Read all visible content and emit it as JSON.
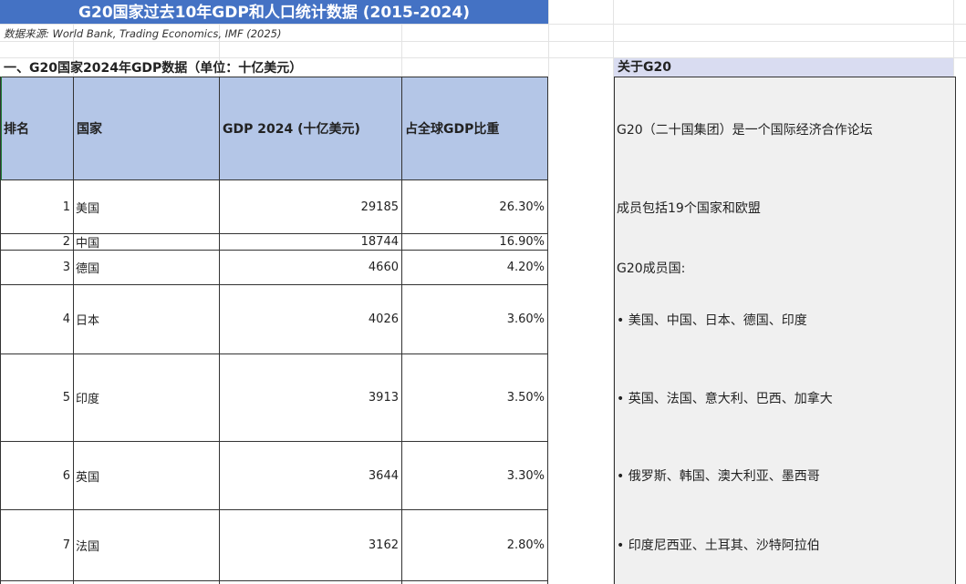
{
  "sheet": {
    "title": "G20国家过去10年GDP和人口统计数据 (2015-2024)",
    "source": "数据来源: World Bank, Trading Economics, IMF (2025)",
    "section_title": "一、G20国家2024年GDP数据（单位：十亿美元）",
    "about_title": "关于G20"
  },
  "table": {
    "headers": [
      "排名",
      "国家",
      "GDP 2024 (十亿美元)",
      "占全球GDP比重"
    ],
    "rows": [
      {
        "rank": "1",
        "country": "美国",
        "gdp": "29185",
        "share": "26.30%"
      },
      {
        "rank": "2",
        "country": "中国",
        "gdp": "18744",
        "share": "16.90%"
      },
      {
        "rank": "3",
        "country": "德国",
        "gdp": "4660",
        "share": "4.20%"
      },
      {
        "rank": "4",
        "country": "日本",
        "gdp": "4026",
        "share": "3.60%"
      },
      {
        "rank": "5",
        "country": "印度",
        "gdp": "3913",
        "share": "3.50%"
      },
      {
        "rank": "6",
        "country": "英国",
        "gdp": "3644",
        "share": "3.30%"
      },
      {
        "rank": "7",
        "country": "法国",
        "gdp": "3162",
        "share": "2.80%"
      }
    ]
  },
  "about": {
    "lines": [
      "G20（二十国集团）是一个国际经济合作论坛",
      "成员包括19个国家和欧盟",
      "G20成员国:",
      "• 美国、中国、日本、德国、印度",
      "• 英国、法国、意大利、巴西、加拿大",
      "• 俄罗斯、韩国、澳大利亚、墨西哥",
      "• 印度尼西亚、土耳其、沙特阿拉伯"
    ]
  },
  "colors": {
    "title_bg": "#4472c4",
    "header_bg": "#b4c6e7",
    "about_header_bg": "#d9dcf1",
    "about_body_bg": "#f0f0f0"
  }
}
